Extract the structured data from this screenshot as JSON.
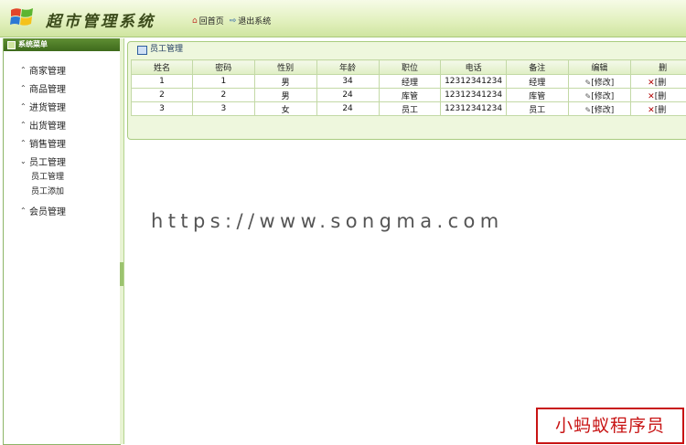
{
  "header": {
    "app_title": "超市管理系统",
    "home_label": "回首页",
    "logout_label": "退出系统"
  },
  "sidebar": {
    "title": "系统菜单",
    "menu": [
      {
        "label": "商家管理",
        "expanded": false
      },
      {
        "label": "商品管理",
        "expanded": false
      },
      {
        "label": "进货管理",
        "expanded": false
      },
      {
        "label": "出货管理",
        "expanded": false
      },
      {
        "label": "销售管理",
        "expanded": false
      },
      {
        "label": "员工管理",
        "expanded": true
      },
      {
        "label": "会员管理",
        "expanded": false
      }
    ],
    "submenu": [
      "员工管理",
      "员工添加"
    ]
  },
  "panel": {
    "title": "员工管理",
    "columns": [
      "姓名",
      "密码",
      "性别",
      "年龄",
      "职位",
      "电话",
      "备注",
      "编辑",
      "删"
    ],
    "rows": [
      {
        "name": "1",
        "password": "1",
        "gender": "男",
        "age": "34",
        "position": "经理",
        "phone": "12312341234",
        "note": "经理",
        "edit": "[修改]",
        "delete": "[删"
      },
      {
        "name": "2",
        "password": "2",
        "gender": "男",
        "age": "24",
        "position": "库管",
        "phone": "12312341234",
        "note": "库管",
        "edit": "[修改]",
        "delete": "[删"
      },
      {
        "name": "3",
        "password": "3",
        "gender": "女",
        "age": "24",
        "position": "员工",
        "phone": "12312341234",
        "note": "员工",
        "edit": "[修改]",
        "delete": "[删"
      }
    ]
  },
  "watermark": "https://www.songma.com",
  "stamp": "小蚂蚁程序员",
  "colors": {
    "header_bg": "#e3f1c0",
    "sidebar_title_bg": "#4f7d28",
    "panel_bg": "#eef7dd",
    "delete_red": "#b00000",
    "stamp_red": "#c81414"
  },
  "icons": {
    "logo": "windows-logo-icon",
    "home": "home-icon",
    "logout": "logout-icon",
    "expand": "chevron-up-icon",
    "collapse": "chevron-down-icon",
    "edit": "pencil-icon",
    "delete": "x-icon"
  }
}
